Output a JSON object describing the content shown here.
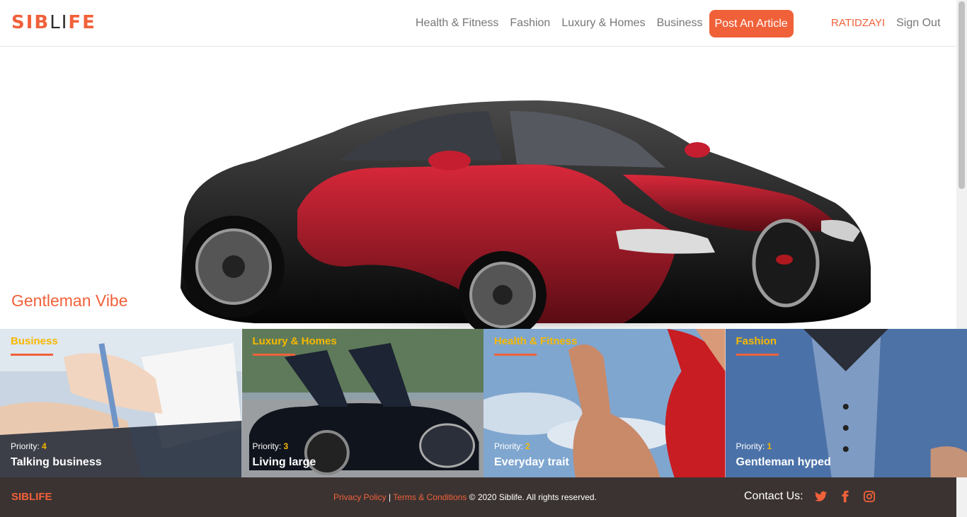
{
  "brand": {
    "part1": "SIB",
    "part2": "LI",
    "part3": "FE"
  },
  "nav": {
    "links": [
      "Health & Fitness",
      "Fashion",
      "Luxury & Homes",
      "Business"
    ],
    "post_button": "Post An Article",
    "user": "RATIDZAYI",
    "signout": "Sign Out"
  },
  "hero": {
    "title": "Gentleman Vibe"
  },
  "cards": [
    {
      "category": "Business",
      "priority_label": "Priority:",
      "priority": "4",
      "title": "Talking business"
    },
    {
      "category": "Luxury & Homes",
      "priority_label": "Priority:",
      "priority": "3",
      "title": "Living large"
    },
    {
      "category": "Health & Fitness",
      "priority_label": "Priority:",
      "priority": "2",
      "title": "Everyday trait"
    },
    {
      "category": "Fashion",
      "priority_label": "Priority:",
      "priority": "1",
      "title": "Gentleman hyped"
    }
  ],
  "footer": {
    "brand_a": "SIB",
    "brand_b": "LIFE",
    "privacy": "Privacy Policy",
    "sep": " | ",
    "terms": "Terms & Conditions",
    "copyright": " © 2020 Siblife. All rights reserved.",
    "contact_label": "Contact Us:",
    "social_icons": [
      "twitter-icon",
      "facebook-icon",
      "instagram-icon"
    ]
  },
  "colors": {
    "accent": "#f0613a",
    "highlight": "#f7b800",
    "footer_bg": "#3b3331"
  }
}
